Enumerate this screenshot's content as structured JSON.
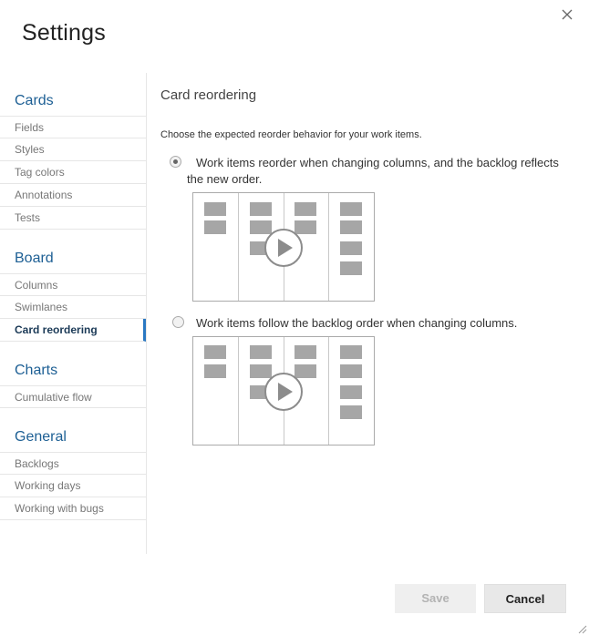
{
  "dialog": {
    "title": "Settings"
  },
  "sidebar": {
    "groups": [
      {
        "title": "Cards",
        "items": [
          "Fields",
          "Styles",
          "Tag colors",
          "Annotations",
          "Tests"
        ]
      },
      {
        "title": "Board",
        "items": [
          "Columns",
          "Swimlanes",
          "Card reordering"
        ]
      },
      {
        "title": "Charts",
        "items": [
          "Cumulative flow"
        ]
      },
      {
        "title": "General",
        "items": [
          "Backlogs",
          "Working days",
          "Working with bugs"
        ]
      }
    ],
    "selected_item": "Card reordering"
  },
  "main": {
    "section_title": "Card reordering",
    "description": "Choose the expected reorder behavior for your work items.",
    "options": [
      {
        "label": "Work items reorder when changing columns, and the backlog reflects the new order.",
        "checked": true
      },
      {
        "label": "Work items follow the backlog order when changing columns.",
        "checked": false
      }
    ]
  },
  "footer": {
    "save_label": "Save",
    "cancel_label": "Cancel"
  },
  "icons": {
    "close": "close-icon",
    "play": "play-icon",
    "resize": "resize-grip-icon"
  },
  "colors": {
    "accent": "#2a78c2",
    "group_title": "#1d5f94",
    "card": "#a6a6a6"
  }
}
